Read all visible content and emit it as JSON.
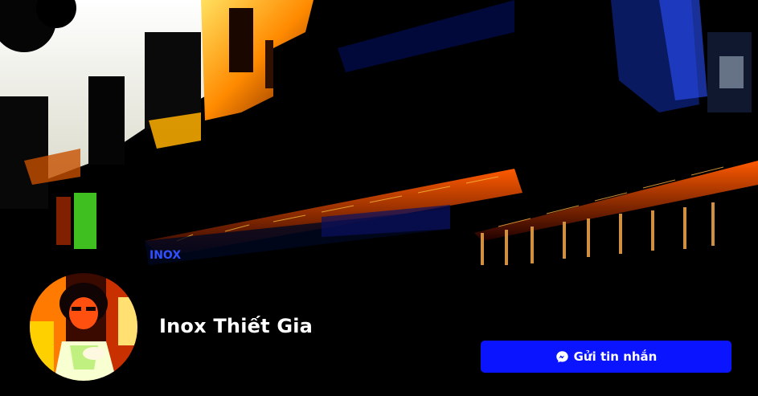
{
  "page": {
    "name": "Inox Thiết Gia",
    "cover_sign_text": "INOX",
    "message_button": {
      "label": "Gửi tin nhắn",
      "icon": "messenger-icon"
    }
  },
  "colors": {
    "button_bg": "#0a14ff",
    "text": "#ffffff",
    "background": "#000000"
  }
}
